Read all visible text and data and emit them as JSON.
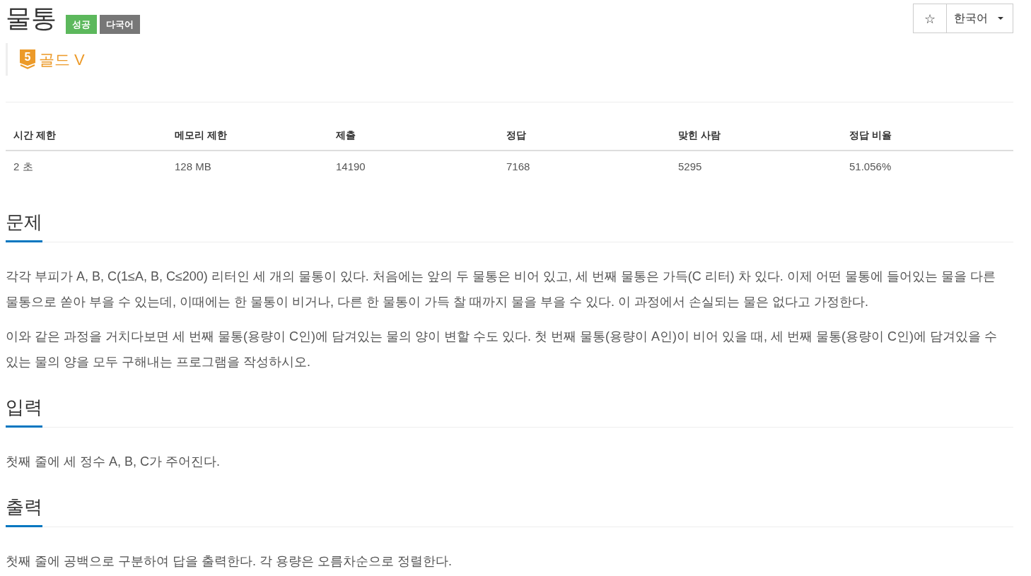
{
  "problem": {
    "title": "물통",
    "badges": [
      {
        "label": "성공",
        "kind": "success"
      },
      {
        "label": "다국어",
        "kind": "multilingual"
      }
    ]
  },
  "toolbar": {
    "star": "☆",
    "language": "한국어"
  },
  "tier": {
    "number": "5",
    "name": "골드 V"
  },
  "stats": {
    "columns": [
      "시간 제한",
      "메모리 제한",
      "제출",
      "정답",
      "맞힌 사람",
      "정답 비율"
    ],
    "rows": [
      [
        "2 초",
        "128 MB",
        "14190",
        "7168",
        "5295",
        "51.056%"
      ]
    ]
  },
  "sections": [
    {
      "title": "문제",
      "paragraphs": [
        "각각 부피가 A, B, C(1≤A, B, C≤200) 리터인 세 개의 물통이 있다. 처음에는 앞의 두 물통은 비어 있고, 세 번째 물통은 가득(C 리터) 차 있다. 이제 어떤 물통에 들어있는 물을 다른 물통으로 쏟아 부을 수 있는데, 이때에는 한 물통이 비거나, 다른 한 물통이 가득 찰 때까지 물을 부을 수 있다. 이 과정에서 손실되는 물은 없다고 가정한다.",
        "이와 같은 과정을 거치다보면 세 번째 물통(용량이 C인)에 담겨있는 물의 양이 변할 수도 있다. 첫 번째 물통(용량이 A인)이 비어 있을 때, 세 번째 물통(용량이 C인)에 담겨있을 수 있는 물의 양을 모두 구해내는 프로그램을 작성하시오."
      ]
    },
    {
      "title": "입력",
      "paragraphs": [
        "첫째 줄에 세 정수 A, B, C가 주어진다."
      ]
    },
    {
      "title": "출력",
      "paragraphs": [
        "첫째 줄에 공백으로 구분하여 답을 출력한다. 각 용량은 오름차순으로 정렬한다."
      ]
    }
  ]
}
